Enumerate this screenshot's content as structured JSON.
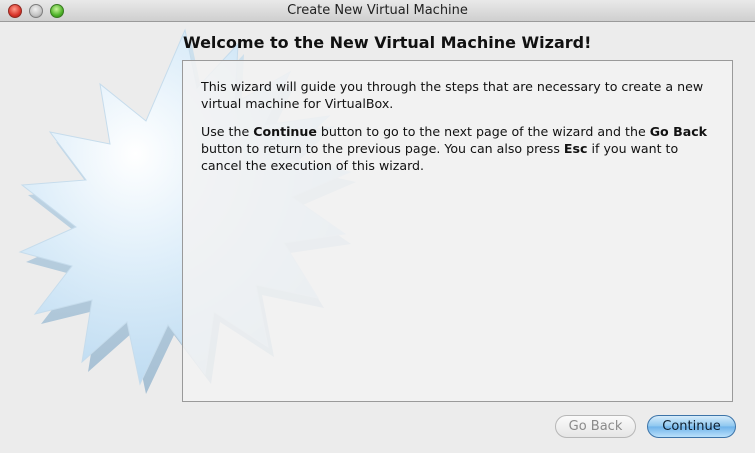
{
  "window": {
    "title": "Create New Virtual Machine"
  },
  "wizard": {
    "heading": "Welcome to the New Virtual Machine Wizard!",
    "paragraph1": "This wizard will guide you through the steps that are necessary to create a new virtual machine for VirtualBox.",
    "paragraph2": {
      "t1": "Use the ",
      "b1": "Continue",
      "t2": " button to go to the next page of the wizard and the ",
      "b2": "Go Back",
      "t3": " button to return to the previous page. You can also press ",
      "b3": "Esc",
      "t4": " if you want to cancel the execution of this wizard."
    }
  },
  "buttons": {
    "go_back": "Go Back",
    "continue": "Continue"
  },
  "colors": {
    "accent_button": "#6fb3ea",
    "window_bg": "#ececec",
    "star_tint": "#bcdcf2"
  }
}
